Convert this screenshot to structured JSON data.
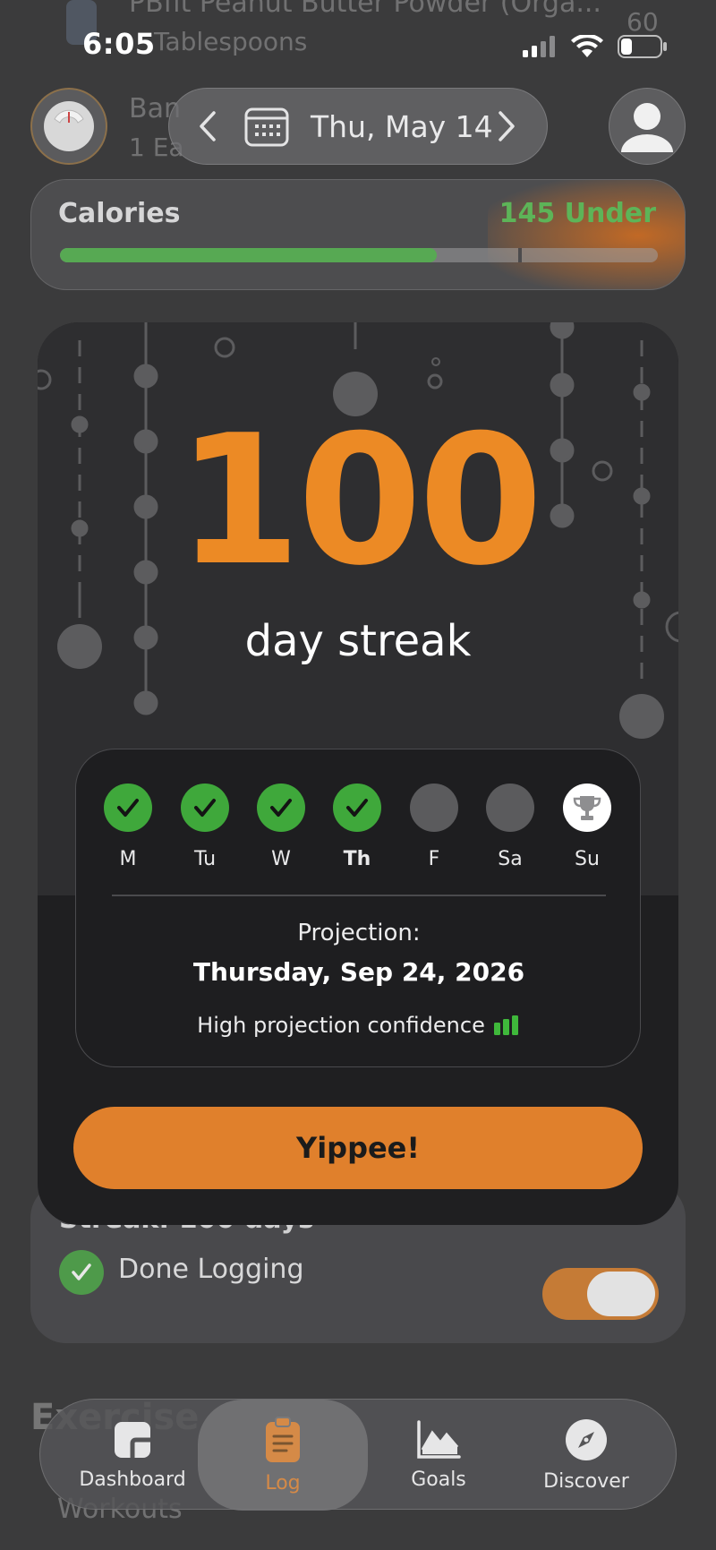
{
  "status_bar": {
    "time": "6:05"
  },
  "background": {
    "food_rows": [
      {
        "name": "PBfit Peanut Butter Powder (Orga...",
        "portion": "Tablespoons",
        "calories": "60"
      },
      {
        "name": "Ban",
        "portion": "1 Ea"
      }
    ],
    "date_nav": {
      "label": "Thu, May 14"
    },
    "calories": {
      "title": "Calories",
      "status": "145 Under",
      "progress": 0.63
    },
    "streak": {
      "title": "Streak: 100 days",
      "done_label": "Done Logging",
      "toggle_on": true
    },
    "section_title": "Exercise",
    "section_item": "Workouts"
  },
  "tabbar": {
    "tabs": [
      {
        "label": "Dashboard",
        "icon": "dashboard-icon",
        "active": false
      },
      {
        "label": "Log",
        "icon": "clipboard-icon",
        "active": true
      },
      {
        "label": "Goals",
        "icon": "chart-icon",
        "active": false
      },
      {
        "label": "Discover",
        "icon": "compass-icon",
        "active": false
      }
    ]
  },
  "modal": {
    "streak_count": "100",
    "streak_label": "day streak",
    "week": [
      {
        "label": "M",
        "state": "done"
      },
      {
        "label": "Tu",
        "state": "done"
      },
      {
        "label": "W",
        "state": "done"
      },
      {
        "label": "Th",
        "state": "done",
        "today": true
      },
      {
        "label": "F",
        "state": "todo"
      },
      {
        "label": "Sa",
        "state": "todo"
      },
      {
        "label": "Su",
        "state": "goal"
      }
    ],
    "projection_label": "Projection:",
    "projection_date": "Thursday, Sep 24, 2026",
    "confidence": "High projection confidence",
    "button": "Yippee!"
  },
  "colors": {
    "accent_orange": "#ec8a25",
    "button_orange": "#e0802c",
    "success_green": "#3fa83b",
    "under_green": "#5db458"
  }
}
